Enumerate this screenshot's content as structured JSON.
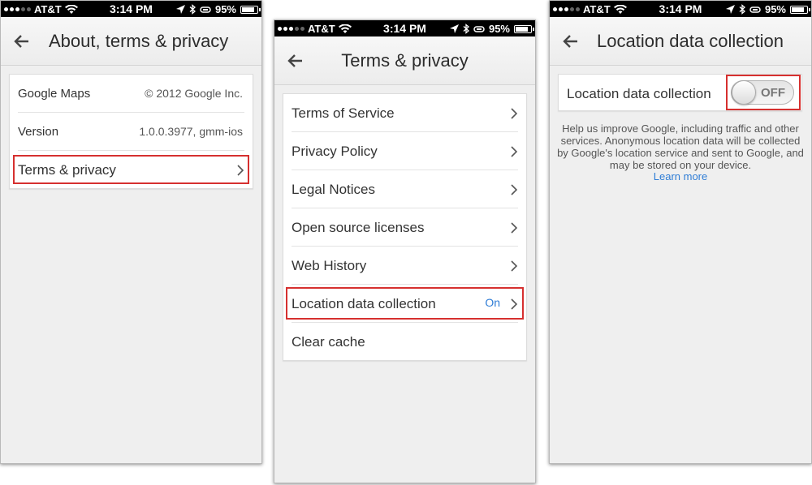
{
  "status_bar": {
    "carrier": "AT&T",
    "time": "3:14 PM",
    "battery": "95%"
  },
  "screen1": {
    "title": "About, terms & privacy",
    "rows": [
      {
        "label": "Google Maps",
        "value": "© 2012 Google Inc."
      },
      {
        "label": "Version",
        "value": "1.0.0.3977, gmm-ios"
      },
      {
        "label": "Terms & privacy"
      }
    ]
  },
  "screen2": {
    "title": "Terms & privacy",
    "rows": [
      {
        "label": "Terms of Service"
      },
      {
        "label": "Privacy Policy"
      },
      {
        "label": "Legal Notices"
      },
      {
        "label": "Open source licenses"
      },
      {
        "label": "Web History"
      },
      {
        "label": "Location data collection",
        "value": "On"
      },
      {
        "label": "Clear cache"
      }
    ]
  },
  "screen3": {
    "title": "Location data collection",
    "setting_label": "Location data collection",
    "toggle_state": "OFF",
    "help_text": "Help us improve Google, including traffic and other services. Anonymous location data will be collected by Google's location service and sent to Google, and may be stored on your device.",
    "learn_more": "Learn more"
  },
  "colors": {
    "highlight": "#d6302f",
    "link": "#2f7dd6"
  }
}
